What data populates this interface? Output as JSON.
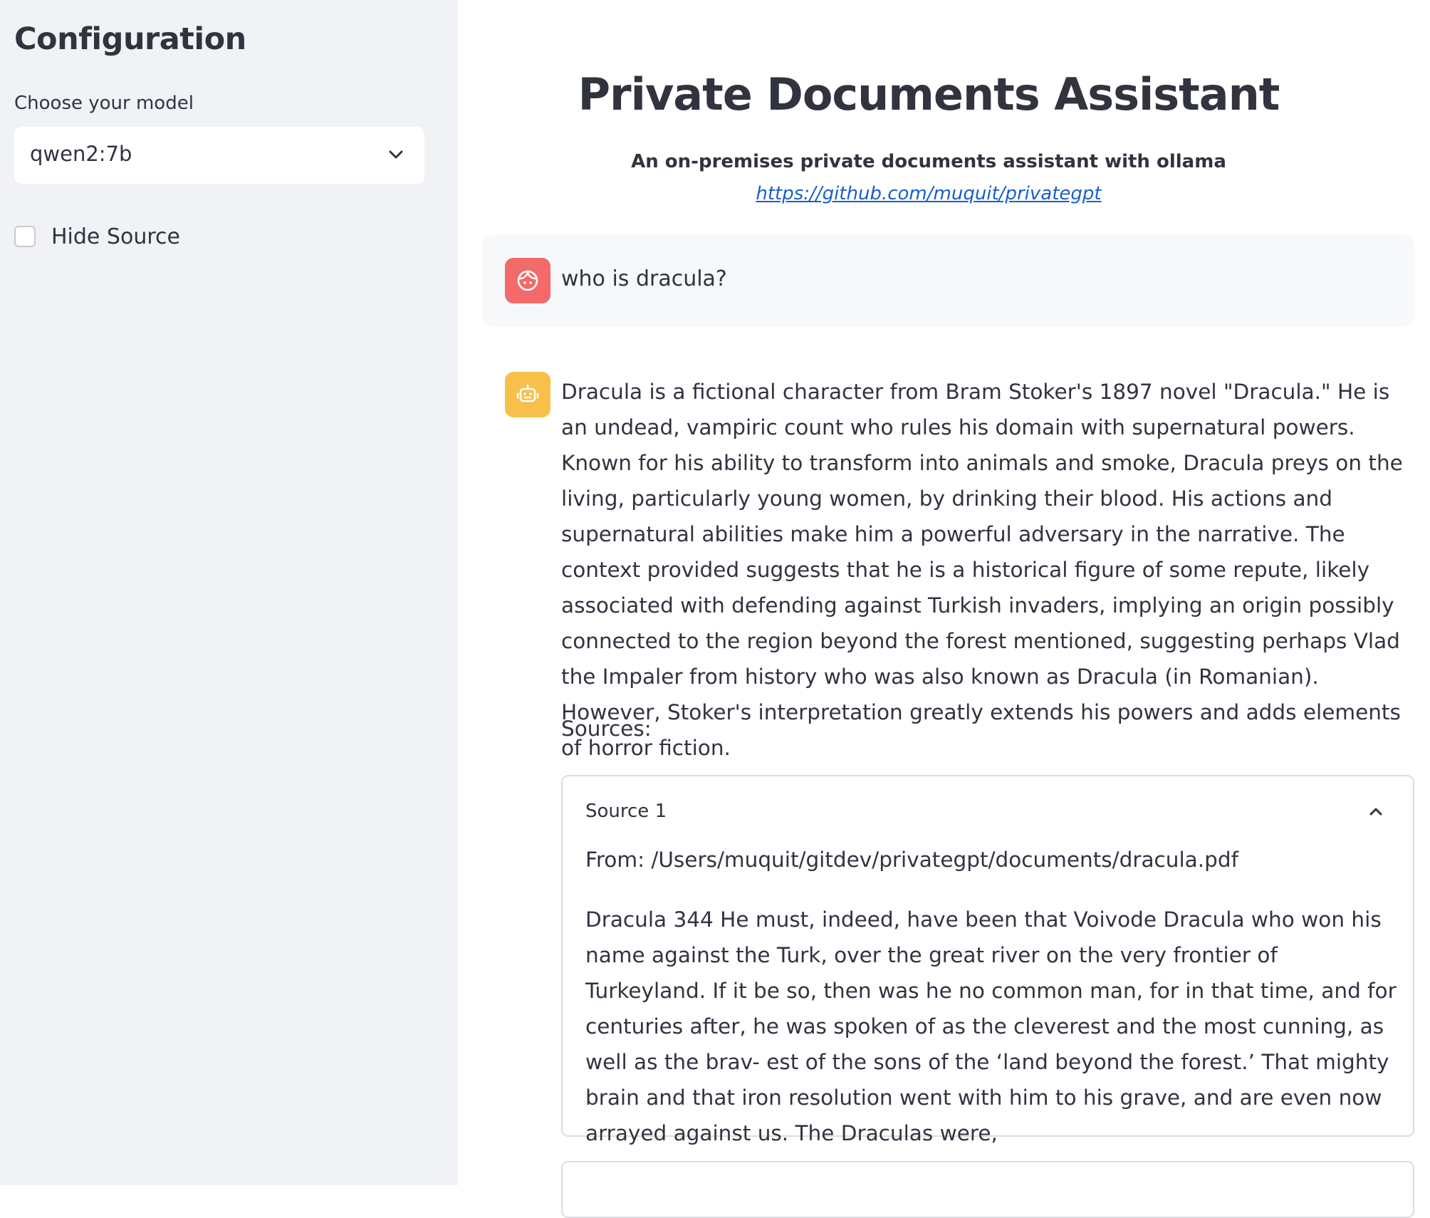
{
  "sidebar": {
    "title": "Configuration",
    "model_select": {
      "label": "Choose your model",
      "value": "qwen2:7b"
    },
    "hide_source": {
      "label": "Hide Source",
      "checked": false
    }
  },
  "header": {
    "title": "Private Documents Assistant",
    "subtitle": "An on-premises private documents assistant with ollama",
    "link": "https://github.com/muquit/privategpt"
  },
  "chat": {
    "user_message": "who is dracula?",
    "assistant_message": "Dracula is a fictional character from Bram Stoker's 1897 novel \"Dracula.\" He is an undead, vampiric count who rules his domain with supernatural powers. Known for his ability to transform into animals and smoke, Dracula preys on the living, particularly young women, by drinking their blood. His actions and supernatural abilities make him a powerful adversary in the narrative. The context provided suggests that he is a historical figure of some repute, likely associated with defending against Turkish invaders, implying an origin possibly connected to the region beyond the forest mentioned, suggesting perhaps Vlad the Impaler from history who was also known as Dracula (in Romanian). However, Stoker's interpretation greatly extends his powers and adds elements of horror fiction.",
    "sources_label": "Sources:",
    "sources": [
      {
        "title": "Source 1",
        "from": "From: /Users/muquit/gitdev/privategpt/documents/dracula.pdf",
        "content": "Dracula 344 He must, indeed, have been that Voivode Dracula who won his name against the Turk, over the great river on the very frontier of Turkeyland. If it be so, then was he no common man, for in that time, and for centuries after, he was spoken of as the cleverest and the most cunning, as well as the brav- est of the sons of the ‘land beyond the forest.’ That mighty brain and that iron resolution went with him to his grave, and are even now arrayed against us. The Draculas were,"
      }
    ]
  },
  "icons": {
    "user_avatar": "user-face-icon",
    "assistant_avatar": "robot-face-icon",
    "select_chevron": "chevron-down-icon",
    "expander_chevron": "chevron-up-icon"
  },
  "colors": {
    "sidebar_bg": "#f0f2f6",
    "user_avatar_bg": "#f26a6a",
    "assistant_avatar_bg": "#f7c04a",
    "link": "#1a5fc7",
    "text": "#31333f"
  }
}
